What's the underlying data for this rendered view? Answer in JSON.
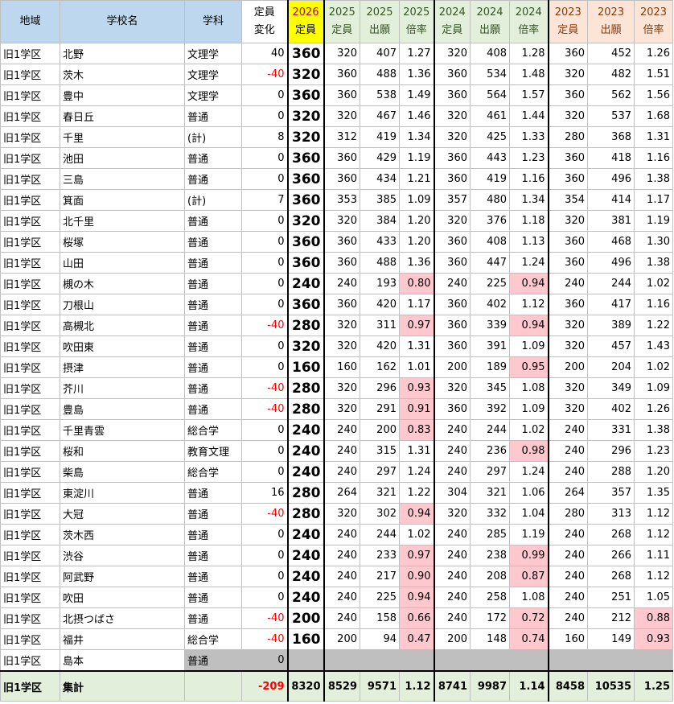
{
  "headers": {
    "region": "地域",
    "school": "学校名",
    "dept": "学科",
    "change": [
      "定員",
      "変化"
    ],
    "cap2026": [
      "2026",
      "定員"
    ],
    "cap2025": [
      "2025",
      "定員"
    ],
    "app2025": [
      "2025",
      "出願"
    ],
    "ratio2025": [
      "2025",
      "倍率"
    ],
    "cap2024": [
      "2024",
      "定員"
    ],
    "app2024": [
      "2024",
      "出願"
    ],
    "ratio2024": [
      "2024",
      "倍率"
    ],
    "cap2023": [
      "2023",
      "定員"
    ],
    "app2023": [
      "2023",
      "出願"
    ],
    "ratio2023": [
      "2023",
      "倍率"
    ]
  },
  "rows": [
    {
      "region": "旧1学区",
      "school": "北野",
      "dept": "文理学",
      "change": "40",
      "cap2026": "360",
      "cap2025": "320",
      "app2025": "407",
      "ratio2025": "1.27",
      "cap2024": "320",
      "app2024": "408",
      "ratio2024": "1.28",
      "cap2023": "360",
      "app2023": "452",
      "ratio2023": "1.26"
    },
    {
      "region": "旧1学区",
      "school": "茨木",
      "dept": "文理学",
      "change": "-40",
      "cap2026": "320",
      "cap2025": "360",
      "app2025": "488",
      "ratio2025": "1.36",
      "cap2024": "360",
      "app2024": "534",
      "ratio2024": "1.48",
      "cap2023": "320",
      "app2023": "482",
      "ratio2023": "1.51"
    },
    {
      "region": "旧1学区",
      "school": "豊中",
      "dept": "文理学",
      "change": "0",
      "cap2026": "360",
      "cap2025": "360",
      "app2025": "538",
      "ratio2025": "1.49",
      "cap2024": "360",
      "app2024": "564",
      "ratio2024": "1.57",
      "cap2023": "360",
      "app2023": "562",
      "ratio2023": "1.56"
    },
    {
      "region": "旧1学区",
      "school": "春日丘",
      "dept": "普通",
      "change": "0",
      "cap2026": "320",
      "cap2025": "320",
      "app2025": "467",
      "ratio2025": "1.46",
      "cap2024": "320",
      "app2024": "461",
      "ratio2024": "1.44",
      "cap2023": "320",
      "app2023": "537",
      "ratio2023": "1.68"
    },
    {
      "region": "旧1学区",
      "school": "千里",
      "dept": "(計)",
      "change": "8",
      "cap2026": "320",
      "cap2025": "312",
      "app2025": "419",
      "ratio2025": "1.34",
      "cap2024": "320",
      "app2024": "425",
      "ratio2024": "1.33",
      "cap2023": "280",
      "app2023": "368",
      "ratio2023": "1.31"
    },
    {
      "region": "旧1学区",
      "school": "池田",
      "dept": "普通",
      "change": "0",
      "cap2026": "360",
      "cap2025": "360",
      "app2025": "429",
      "ratio2025": "1.19",
      "cap2024": "360",
      "app2024": "443",
      "ratio2024": "1.23",
      "cap2023": "360",
      "app2023": "418",
      "ratio2023": "1.16"
    },
    {
      "region": "旧1学区",
      "school": "三島",
      "dept": "普通",
      "change": "0",
      "cap2026": "360",
      "cap2025": "360",
      "app2025": "434",
      "ratio2025": "1.21",
      "cap2024": "360",
      "app2024": "419",
      "ratio2024": "1.16",
      "cap2023": "360",
      "app2023": "496",
      "ratio2023": "1.38"
    },
    {
      "region": "旧1学区",
      "school": "箕面",
      "dept": "(計)",
      "change": "7",
      "cap2026": "360",
      "cap2025": "353",
      "app2025": "385",
      "ratio2025": "1.09",
      "cap2024": "357",
      "app2024": "480",
      "ratio2024": "1.34",
      "cap2023": "354",
      "app2023": "414",
      "ratio2023": "1.17"
    },
    {
      "region": "旧1学区",
      "school": "北千里",
      "dept": "普通",
      "change": "0",
      "cap2026": "320",
      "cap2025": "320",
      "app2025": "384",
      "ratio2025": "1.20",
      "cap2024": "320",
      "app2024": "376",
      "ratio2024": "1.18",
      "cap2023": "320",
      "app2023": "381",
      "ratio2023": "1.19"
    },
    {
      "region": "旧1学区",
      "school": "桜塚",
      "dept": "普通",
      "change": "0",
      "cap2026": "360",
      "cap2025": "360",
      "app2025": "433",
      "ratio2025": "1.20",
      "cap2024": "360",
      "app2024": "408",
      "ratio2024": "1.13",
      "cap2023": "360",
      "app2023": "468",
      "ratio2023": "1.30"
    },
    {
      "region": "旧1学区",
      "school": "山田",
      "dept": "普通",
      "change": "0",
      "cap2026": "360",
      "cap2025": "360",
      "app2025": "488",
      "ratio2025": "1.36",
      "cap2024": "360",
      "app2024": "447",
      "ratio2024": "1.24",
      "cap2023": "360",
      "app2023": "496",
      "ratio2023": "1.38"
    },
    {
      "region": "旧1学区",
      "school": "槻の木",
      "dept": "普通",
      "change": "0",
      "cap2026": "240",
      "cap2025": "240",
      "app2025": "193",
      "ratio2025": "0.80",
      "cap2024": "240",
      "app2024": "225",
      "ratio2024": "0.94",
      "cap2023": "240",
      "app2023": "244",
      "ratio2023": "1.02"
    },
    {
      "region": "旧1学区",
      "school": "刀根山",
      "dept": "普通",
      "change": "0",
      "cap2026": "360",
      "cap2025": "360",
      "app2025": "420",
      "ratio2025": "1.17",
      "cap2024": "360",
      "app2024": "402",
      "ratio2024": "1.12",
      "cap2023": "360",
      "app2023": "417",
      "ratio2023": "1.16"
    },
    {
      "region": "旧1学区",
      "school": "高槻北",
      "dept": "普通",
      "change": "-40",
      "cap2026": "280",
      "cap2025": "320",
      "app2025": "311",
      "ratio2025": "0.97",
      "cap2024": "360",
      "app2024": "339",
      "ratio2024": "0.94",
      "cap2023": "320",
      "app2023": "389",
      "ratio2023": "1.22"
    },
    {
      "region": "旧1学区",
      "school": "吹田東",
      "dept": "普通",
      "change": "0",
      "cap2026": "320",
      "cap2025": "320",
      "app2025": "420",
      "ratio2025": "1.31",
      "cap2024": "360",
      "app2024": "391",
      "ratio2024": "1.09",
      "cap2023": "320",
      "app2023": "457",
      "ratio2023": "1.43"
    },
    {
      "region": "旧1学区",
      "school": "摂津",
      "dept": "普通",
      "change": "0",
      "cap2026": "160",
      "cap2025": "160",
      "app2025": "162",
      "ratio2025": "1.01",
      "cap2024": "200",
      "app2024": "189",
      "ratio2024": "0.95",
      "cap2023": "200",
      "app2023": "204",
      "ratio2023": "1.02"
    },
    {
      "region": "旧1学区",
      "school": "芥川",
      "dept": "普通",
      "change": "-40",
      "cap2026": "280",
      "cap2025": "320",
      "app2025": "296",
      "ratio2025": "0.93",
      "cap2024": "320",
      "app2024": "345",
      "ratio2024": "1.08",
      "cap2023": "320",
      "app2023": "349",
      "ratio2023": "1.09"
    },
    {
      "region": "旧1学区",
      "school": "豊島",
      "dept": "普通",
      "change": "-40",
      "cap2026": "280",
      "cap2025": "320",
      "app2025": "291",
      "ratio2025": "0.91",
      "cap2024": "360",
      "app2024": "392",
      "ratio2024": "1.09",
      "cap2023": "320",
      "app2023": "402",
      "ratio2023": "1.26"
    },
    {
      "region": "旧1学区",
      "school": "千里青雲",
      "dept": "総合学",
      "change": "0",
      "cap2026": "240",
      "cap2025": "240",
      "app2025": "200",
      "ratio2025": "0.83",
      "cap2024": "240",
      "app2024": "244",
      "ratio2024": "1.02",
      "cap2023": "240",
      "app2023": "331",
      "ratio2023": "1.38"
    },
    {
      "region": "旧1学区",
      "school": "桜和",
      "dept": "教育文理",
      "change": "0",
      "cap2026": "240",
      "cap2025": "240",
      "app2025": "315",
      "ratio2025": "1.31",
      "cap2024": "240",
      "app2024": "236",
      "ratio2024": "0.98",
      "cap2023": "240",
      "app2023": "296",
      "ratio2023": "1.23"
    },
    {
      "region": "旧1学区",
      "school": "柴島",
      "dept": "総合学",
      "change": "0",
      "cap2026": "240",
      "cap2025": "240",
      "app2025": "297",
      "ratio2025": "1.24",
      "cap2024": "240",
      "app2024": "297",
      "ratio2024": "1.24",
      "cap2023": "240",
      "app2023": "288",
      "ratio2023": "1.20"
    },
    {
      "region": "旧1学区",
      "school": "東淀川",
      "dept": "普通",
      "change": "16",
      "cap2026": "280",
      "cap2025": "264",
      "app2025": "321",
      "ratio2025": "1.22",
      "cap2024": "304",
      "app2024": "321",
      "ratio2024": "1.06",
      "cap2023": "264",
      "app2023": "357",
      "ratio2023": "1.35"
    },
    {
      "region": "旧1学区",
      "school": "大冠",
      "dept": "普通",
      "change": "-40",
      "cap2026": "280",
      "cap2025": "320",
      "app2025": "302",
      "ratio2025": "0.94",
      "cap2024": "320",
      "app2024": "332",
      "ratio2024": "1.04",
      "cap2023": "280",
      "app2023": "313",
      "ratio2023": "1.12"
    },
    {
      "region": "旧1学区",
      "school": "茨木西",
      "dept": "普通",
      "change": "0",
      "cap2026": "240",
      "cap2025": "240",
      "app2025": "244",
      "ratio2025": "1.02",
      "cap2024": "240",
      "app2024": "285",
      "ratio2024": "1.19",
      "cap2023": "240",
      "app2023": "268",
      "ratio2023": "1.12"
    },
    {
      "region": "旧1学区",
      "school": "渋谷",
      "dept": "普通",
      "change": "0",
      "cap2026": "240",
      "cap2025": "240",
      "app2025": "233",
      "ratio2025": "0.97",
      "cap2024": "240",
      "app2024": "238",
      "ratio2024": "0.99",
      "cap2023": "240",
      "app2023": "266",
      "ratio2023": "1.11"
    },
    {
      "region": "旧1学区",
      "school": "阿武野",
      "dept": "普通",
      "change": "0",
      "cap2026": "240",
      "cap2025": "240",
      "app2025": "217",
      "ratio2025": "0.90",
      "cap2024": "240",
      "app2024": "208",
      "ratio2024": "0.87",
      "cap2023": "240",
      "app2023": "268",
      "ratio2023": "1.12"
    },
    {
      "region": "旧1学区",
      "school": "吹田",
      "dept": "普通",
      "change": "0",
      "cap2026": "240",
      "cap2025": "240",
      "app2025": "225",
      "ratio2025": "0.94",
      "cap2024": "240",
      "app2024": "258",
      "ratio2024": "1.08",
      "cap2023": "240",
      "app2023": "251",
      "ratio2023": "1.05"
    },
    {
      "region": "旧1学区",
      "school": "北摂つばさ",
      "dept": "普通",
      "change": "-40",
      "cap2026": "200",
      "cap2025": "240",
      "app2025": "158",
      "ratio2025": "0.66",
      "cap2024": "240",
      "app2024": "172",
      "ratio2024": "0.72",
      "cap2023": "240",
      "app2023": "212",
      "ratio2023": "0.88"
    },
    {
      "region": "旧1学区",
      "school": "福井",
      "dept": "総合学",
      "change": "-40",
      "cap2026": "160",
      "cap2025": "200",
      "app2025": "94",
      "ratio2025": "0.47",
      "cap2024": "200",
      "app2024": "148",
      "ratio2024": "0.74",
      "cap2023": "160",
      "app2023": "149",
      "ratio2023": "0.93"
    },
    {
      "region": "旧1学区",
      "school": "島本",
      "dept": "普通",
      "change": "0",
      "cap2026": "",
      "cap2025": "",
      "app2025": "",
      "ratio2025": "",
      "cap2024": "",
      "app2024": "",
      "ratio2024": "",
      "cap2023": "",
      "app2023": "",
      "ratio2023": "",
      "gray": true
    }
  ],
  "total": {
    "region": "旧1学区",
    "school": "集計",
    "dept": "",
    "change": "-209",
    "cap2026": "8320",
    "cap2025": "8529",
    "app2025": "9571",
    "ratio2025": "1.12",
    "cap2024": "8741",
    "app2024": "9987",
    "ratio2024": "1.14",
    "cap2023": "8458",
    "app2023": "10535",
    "ratio2023": "1.25"
  },
  "colors": {
    "header_blue": "#bdd7ee",
    "year_2026": "#ffff00",
    "year_2025_2024": "#e2efda",
    "year_2023": "#fce4d6",
    "below_one": "#ffc7ce",
    "negative": "#ff0000",
    "total_row": "#e2efda"
  }
}
